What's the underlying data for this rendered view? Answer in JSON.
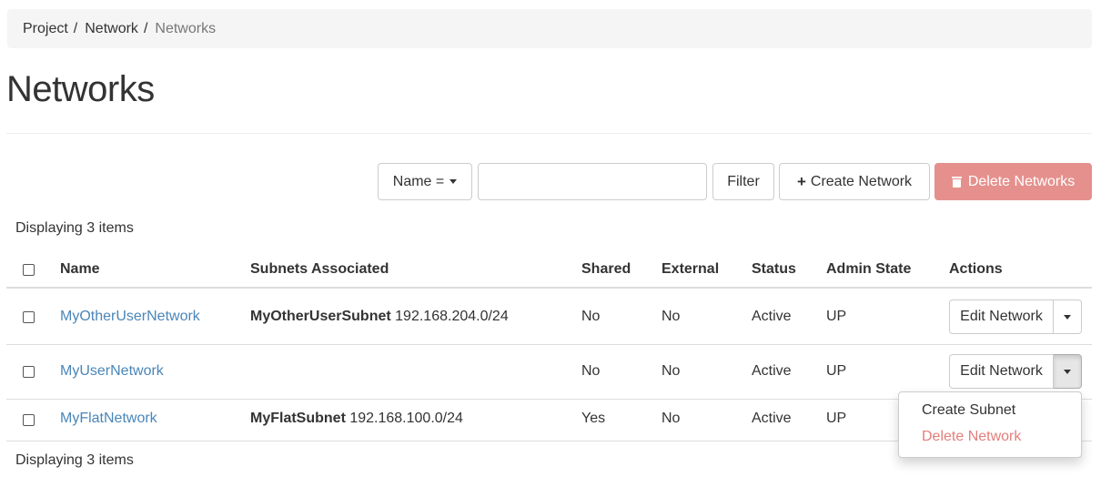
{
  "breadcrumb": {
    "items": [
      "Project",
      "Network"
    ],
    "current": "Networks",
    "separator": "/"
  },
  "page": {
    "title": "Networks"
  },
  "toolbar": {
    "filter_select_label": "Name =",
    "filter_input_value": "",
    "filter_button": "Filter",
    "create_button": "Create Network",
    "delete_button": "Delete Networks"
  },
  "table": {
    "count_text": "Displaying 3 items",
    "columns": [
      "Name",
      "Subnets Associated",
      "Shared",
      "External",
      "Status",
      "Admin State",
      "Actions"
    ],
    "rows": [
      {
        "name": "MyOtherUserNetwork",
        "subnet_name": "MyOtherUserSubnet",
        "subnet_cidr": "192.168.204.0/24",
        "shared": "No",
        "external": "No",
        "status": "Active",
        "admin_state": "UP",
        "action": "Edit Network"
      },
      {
        "name": "MyUserNetwork",
        "subnet_name": "",
        "subnet_cidr": "",
        "shared": "No",
        "external": "No",
        "status": "Active",
        "admin_state": "UP",
        "action": "Edit Network"
      },
      {
        "name": "MyFlatNetwork",
        "subnet_name": "MyFlatSubnet",
        "subnet_cidr": "192.168.100.0/24",
        "shared": "Yes",
        "external": "No",
        "status": "Active",
        "admin_state": "UP",
        "action": ""
      }
    ]
  },
  "row_dropdown": {
    "items": [
      "Create Subnet",
      "Delete Network"
    ]
  },
  "colors": {
    "link": "#4a86b8",
    "danger": "#d9534f",
    "delete_button_bg": "#e5908d",
    "breadcrumb_bg": "#f5f5f5"
  }
}
